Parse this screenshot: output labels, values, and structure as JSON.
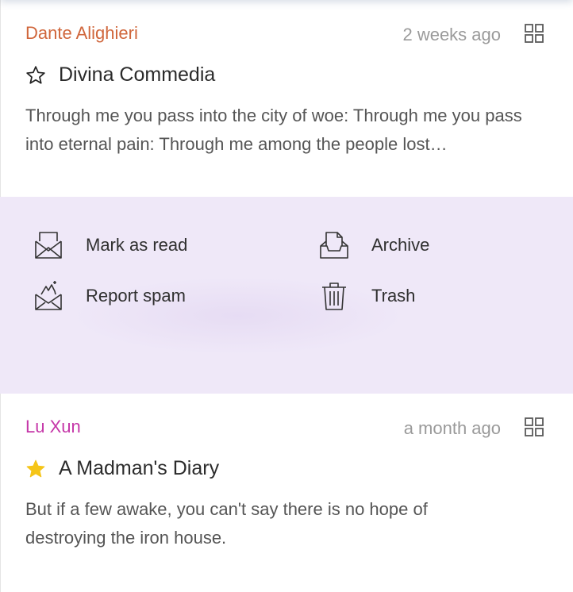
{
  "messages": [
    {
      "author": "Dante Alighieri",
      "time": "2 weeks ago",
      "starred": false,
      "title": "Divina Commedia",
      "excerpt": "Through me you pass into the city of woe: Through me you pass into eternal pain: Through me among the people lost…"
    },
    {
      "author": "Lu Xun",
      "time": "a month ago",
      "starred": true,
      "title": "A Madman's Diary",
      "excerpt": "But if a few awake, you can't say there is no hope of destroying the iron house."
    }
  ],
  "actions": {
    "mark_read": "Mark as read",
    "archive": "Archive",
    "report_spam": "Report spam",
    "trash": "Trash"
  },
  "icons": {
    "mark_read": "envelope-open-icon",
    "archive": "archive-tray-icon",
    "report_spam": "spam-envelope-icon",
    "trash": "trash-icon",
    "more": "grid-icon",
    "star_empty": "star-outline-icon",
    "star_filled": "star-filled-icon"
  },
  "colors": {
    "author1": "#d0663b",
    "author2": "#c537a8",
    "star_filled": "#f5c518",
    "actions_bg": "#efe8f8"
  }
}
